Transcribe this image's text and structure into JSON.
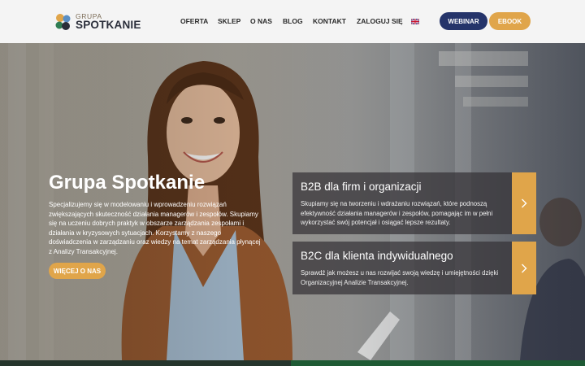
{
  "header": {
    "logo": {
      "small": "GRUPA",
      "big": "SPOTKANIE"
    },
    "nav": [
      "OFERTA",
      "SKLEP",
      "O NAS",
      "BLOG",
      "KONTAKT",
      "ZALOGUJ SIĘ"
    ],
    "language_icon": "uk-flag-icon",
    "webinar_label": "WEBINAR",
    "ebook_label": "EBOOK"
  },
  "hero": {
    "title": "Grupa Spotkanie",
    "text": "Specjalizujemy się w modelowaniu i wprowadzeniu rozwiązań zwiększających skuteczność działania managerów i zespołów. Skupiamy się na uczeniu dobrych praktyk w obszarze zarządzania zespołami i działania w kryzysowych sytuacjach. Korzystamy z naszego doświadczenia w zarządzaniu oraz wiedzy na temat zarządzania płynącej z Analizy Transakcyjnej.",
    "button_label": "WIĘCEJ O NAS"
  },
  "cards": [
    {
      "title": "B2B dla firm i organizacji",
      "text": "Skupiamy się na tworzeniu i wdrażaniu rozwiązań, które podnoszą efektywność działania managerów i zespołów, pomagając im w pełni wykorzystać swój potencjał i osiągać lepsze rezultaty.",
      "icon": "chevron-right-icon"
    },
    {
      "title": "B2C dla klienta indywidualnego",
      "text": "Sprawdź jak możesz u nas rozwijać swoją wiedzę i umiejętności dzięki Organizacyjnej Analizie Transakcyjnej.",
      "icon": "chevron-right-icon"
    }
  ],
  "colors": {
    "navy": "#25346a",
    "accent": "#e0a54a",
    "card_bg": "rgba(52,50,54,0.72)"
  }
}
